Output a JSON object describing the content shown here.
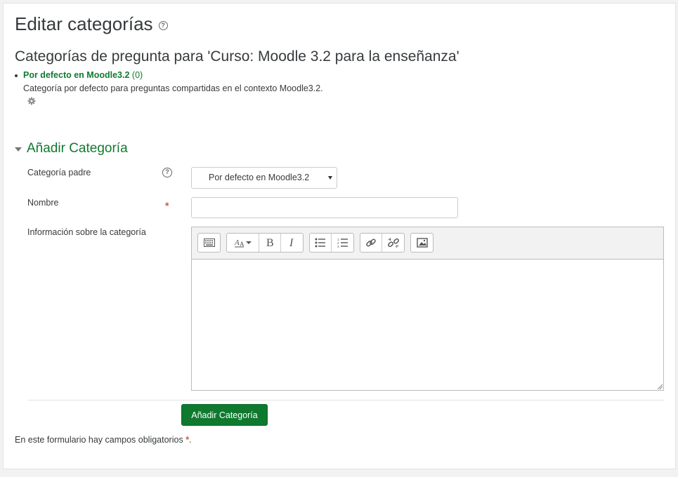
{
  "page": {
    "title": "Editar categorías",
    "help_glyph": "?",
    "subtitle": "Categorías de pregunta para 'Curso: Moodle 3.2 para la enseñanza'"
  },
  "categories": [
    {
      "name": "Por defecto en Moodle3.2",
      "count": "(0)",
      "description": "Categoría por defecto para preguntas compartidas en el contexto Moodle3.2.",
      "action_icon": "gear-icon"
    }
  ],
  "form": {
    "section_title": "Añadir Categoría",
    "parent_label": "Categoría padre",
    "parent_value": "Por defecto en Moodle3.2",
    "name_label": "Nombre",
    "name_value": "",
    "info_label": "Información sobre la categoría",
    "info_value": "",
    "required_glyph": "*",
    "submit_label": "Añadir Categoría",
    "required_note": "En este formulario hay campos obligatorios",
    "required_note_end": "."
  },
  "colors": {
    "accent": "#0f7a2f",
    "required": "#d9534f"
  }
}
